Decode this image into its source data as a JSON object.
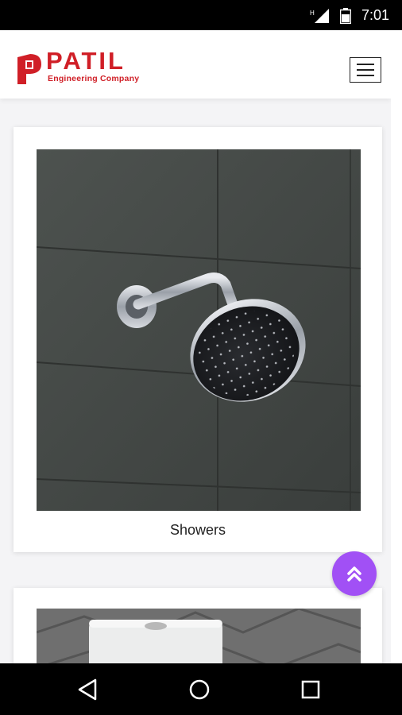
{
  "status_bar": {
    "time": "7:01",
    "network_label": "H"
  },
  "header": {
    "brand_name": "PATIL",
    "brand_subtitle": "Engineering Company",
    "logo_mark_letter": "P",
    "menu_icon": "hamburger-icon"
  },
  "products": [
    {
      "name": "Showers",
      "image": "shower-head-photo"
    },
    {
      "name": "",
      "image": "toilet-photo"
    }
  ],
  "scroll_top_icon": "double-chevron-up-icon",
  "nav": [
    "back-icon",
    "home-icon",
    "recents-icon"
  ],
  "colors": {
    "brand": "#d01f27",
    "fab": "#a150f5"
  }
}
